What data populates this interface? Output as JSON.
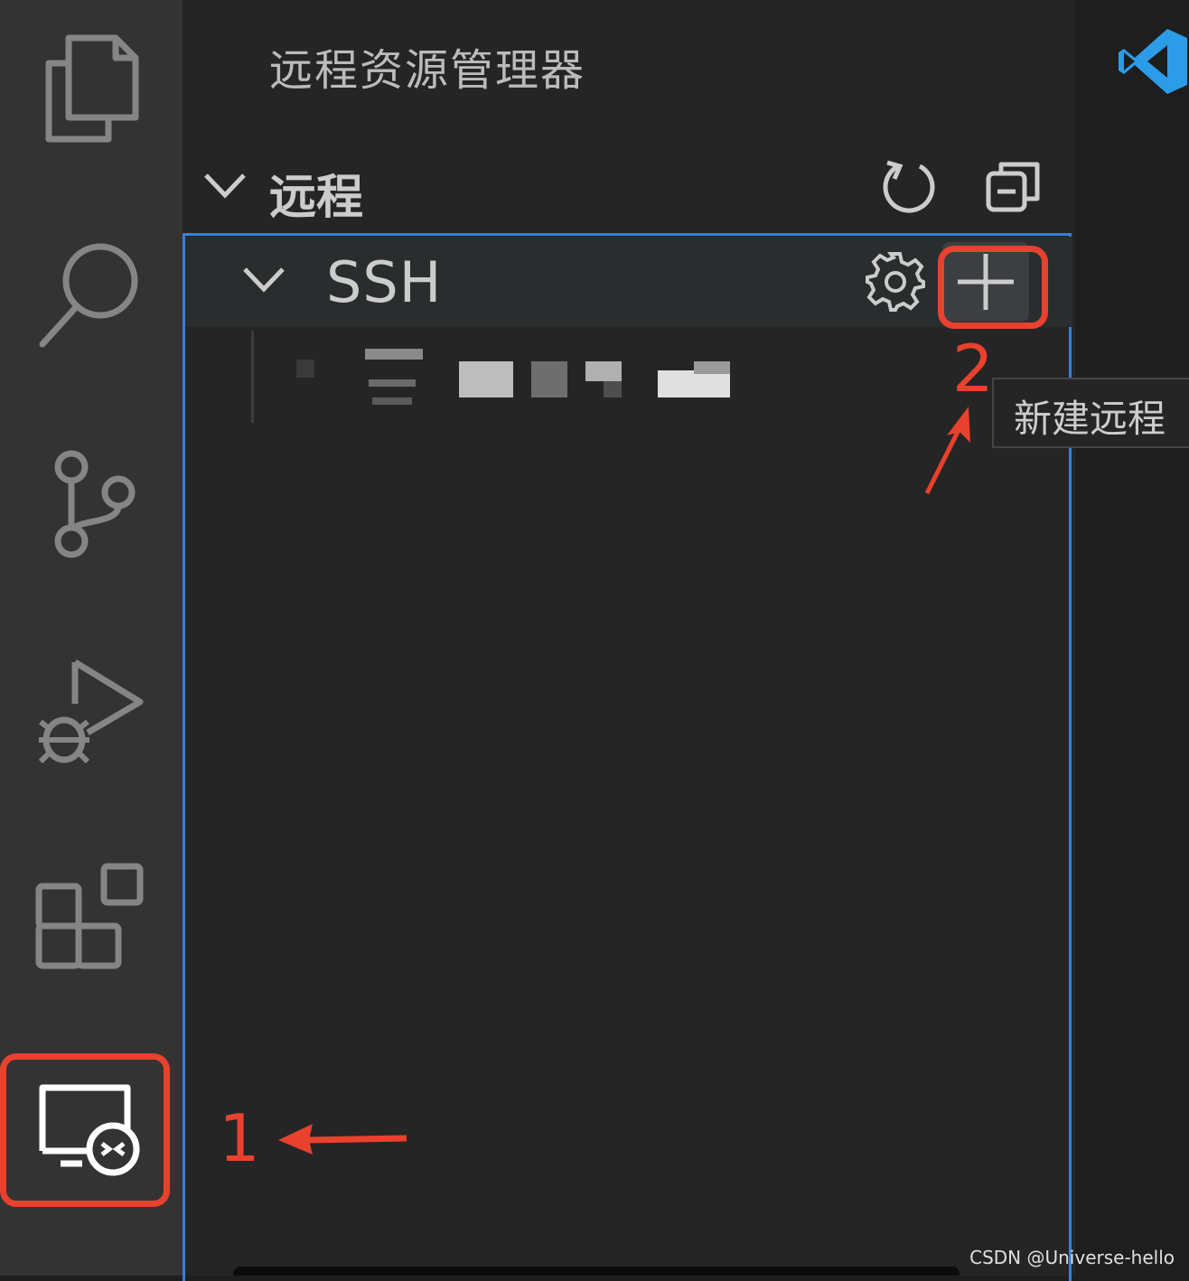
{
  "activity_bar": {
    "items": [
      {
        "icon": "explorer-icon"
      },
      {
        "icon": "search-icon"
      },
      {
        "icon": "source-control-icon"
      },
      {
        "icon": "run-debug-icon"
      },
      {
        "icon": "extensions-icon"
      },
      {
        "icon": "remote-explorer-icon",
        "active": true
      }
    ]
  },
  "sidebar": {
    "title": "远程资源管理器",
    "section": {
      "label": "远程",
      "refresh_icon": "refresh-icon",
      "collapse_icon": "collapse-all-icon"
    },
    "ssh": {
      "label": "SSH",
      "settings_icon": "gear-icon",
      "add_icon": "plus-icon",
      "add_tooltip": "新建远程"
    }
  },
  "annotations": {
    "step1": "1",
    "step2": "2",
    "color": "#e8412d"
  },
  "watermark": "CSDN @Universe-hello",
  "colors": {
    "accent_focus": "#3a7fd4",
    "activity_bar": "#333333",
    "sidebar": "#252526",
    "vscode_blue": "#2d9ce8"
  }
}
